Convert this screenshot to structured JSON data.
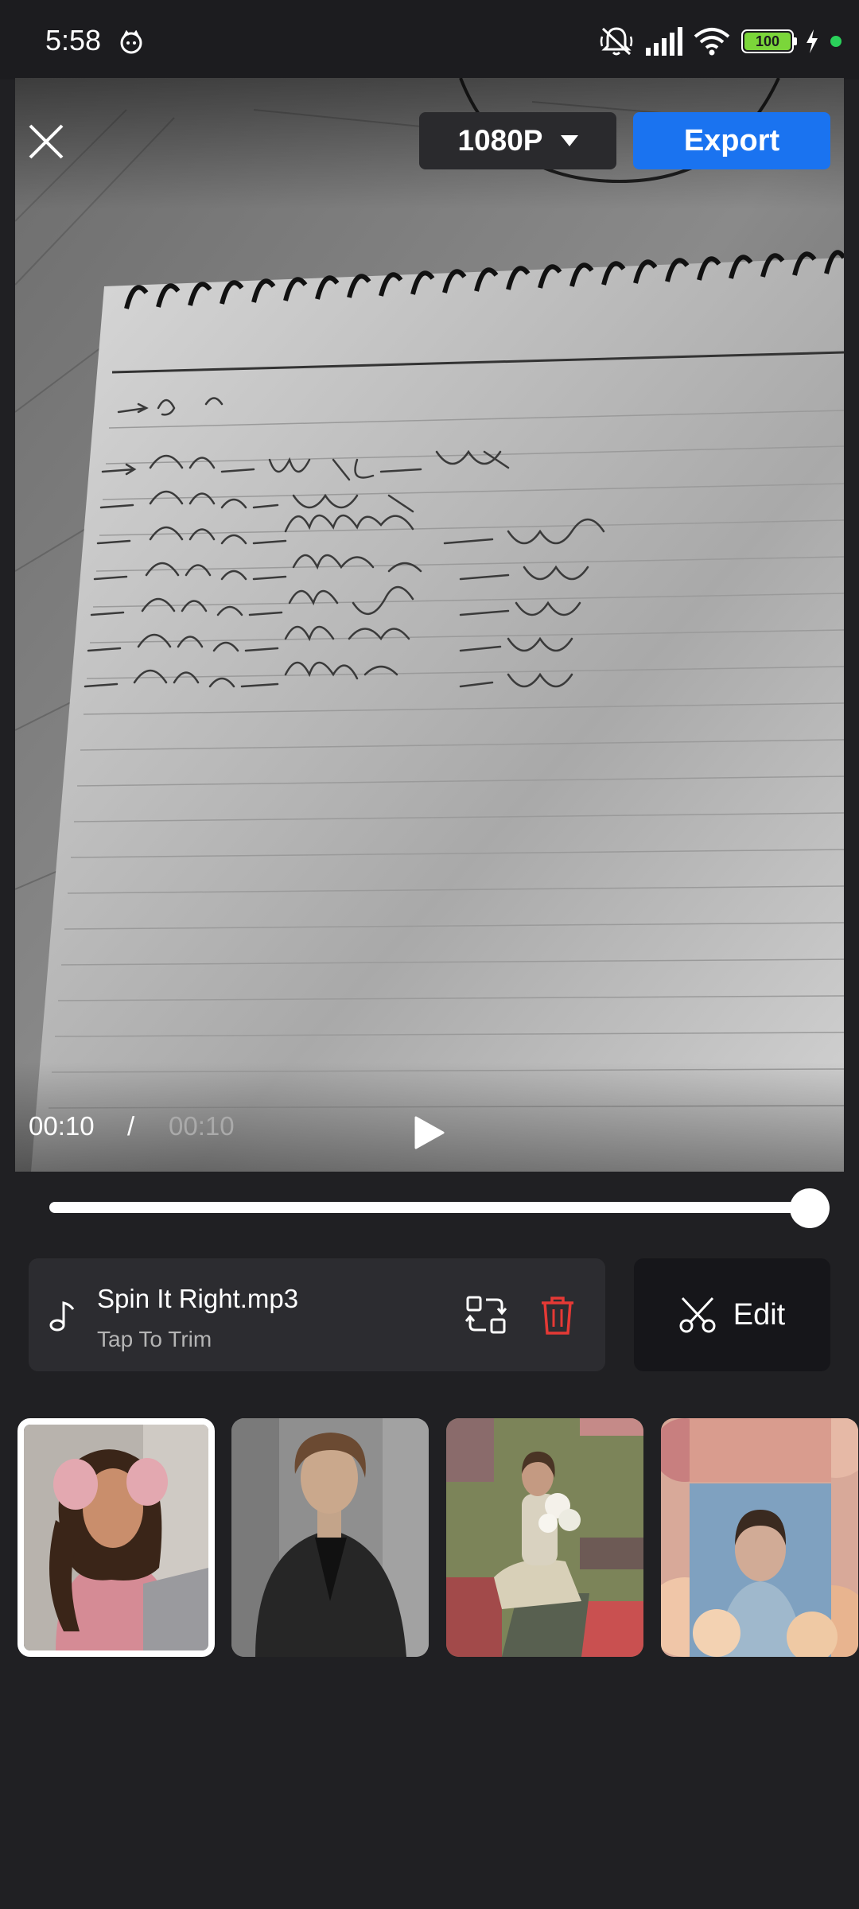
{
  "status_bar": {
    "time": "5:58",
    "battery_level": "100",
    "icons": [
      "cat-app-icon",
      "muted-bell-icon",
      "signal-icon",
      "wifi-icon",
      "battery-icon",
      "charging-bolt-icon",
      "green-dot-indicator"
    ]
  },
  "header": {
    "resolution": "1080P",
    "export_label": "Export",
    "close_icon": "close-icon"
  },
  "player": {
    "current_time": "00:10",
    "separator": "/",
    "total_time": "00:10",
    "progress": 1.0
  },
  "audio": {
    "name": "Spin It Right.mp3",
    "hint": "Tap To Trim"
  },
  "edit": {
    "label": "Edit"
  },
  "thumbnails": [
    {
      "name": "clip-woman-pink-earmuffs",
      "selected": true
    },
    {
      "name": "clip-woman-black-blazer",
      "selected": false
    },
    {
      "name": "clip-woman-with-flowers-collage",
      "selected": false
    },
    {
      "name": "clip-woman-floral-collage",
      "selected": false
    }
  ],
  "colors": {
    "background": "#202023",
    "accent_blue": "#1a73f0",
    "delete_red": "#e53935",
    "card": "#2c2c30"
  }
}
